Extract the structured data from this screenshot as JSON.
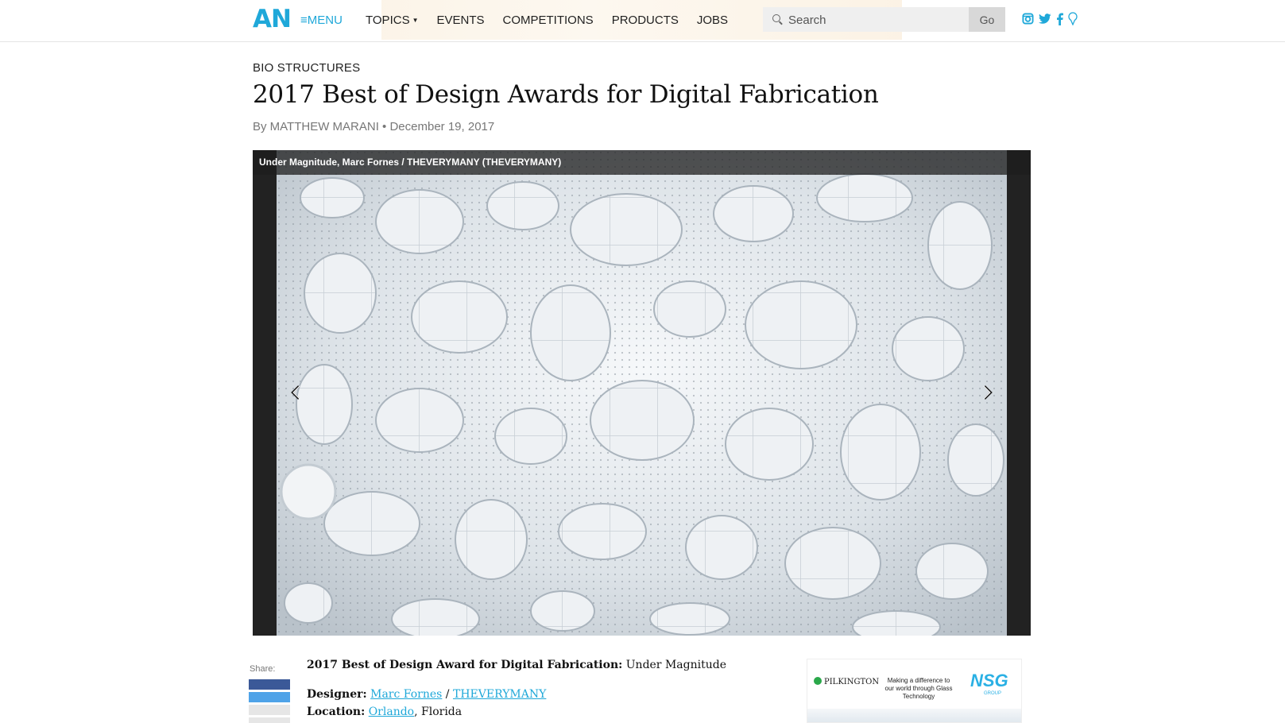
{
  "header": {
    "logo": "AN",
    "menu_label": "≡MENU",
    "nav": [
      {
        "label": "TOPICS",
        "has_caret": true
      },
      {
        "label": "EVENTS"
      },
      {
        "label": "COMPETITIONS"
      },
      {
        "label": "PRODUCTS"
      },
      {
        "label": "JOBS"
      }
    ],
    "search": {
      "placeholder": "Search",
      "value": ""
    },
    "go_label": "Go",
    "social_icons": [
      "instagram-icon",
      "twitter-icon",
      "facebook-icon",
      "pin-icon"
    ],
    "accent_color": "#1fa8d9"
  },
  "article": {
    "kicker": "BIO STRUCTURES",
    "title": "2017 Best of Design Awards for Digital Fabrication",
    "byline": "By MATTHEW MARANI • December 19, 2017"
  },
  "slideshow": {
    "caption": "Under Magnitude, Marc Fornes / THEVERYMANY (THEVERYMANY)",
    "prev_icon": "chevron-left-icon",
    "next_icon": "chevron-right-icon"
  },
  "share": {
    "label": "Share:",
    "buttons": [
      {
        "color": "#3b5998"
      },
      {
        "color": "#4fa3e8"
      },
      {
        "color": "#e6e6e6"
      },
      {
        "color": "#e6e6e6"
      }
    ]
  },
  "body": {
    "award_label": "2017 Best of Design Award for Digital Fabrication:",
    "award_value": " Under Magnitude",
    "designer_label": "Designer:",
    "designer_link1": "Marc Fornes",
    "designer_sep": " / ",
    "designer_link2": "THEVERYMANY",
    "location_label": "Location:",
    "location_link": "Orlando",
    "location_rest": ", Florida"
  },
  "ad": {
    "brand_left": "PILKINGTON",
    "tagline": "Making a difference to our world through Glass Technology",
    "brand_right": "NSG",
    "brand_right_sub": "GROUP"
  }
}
